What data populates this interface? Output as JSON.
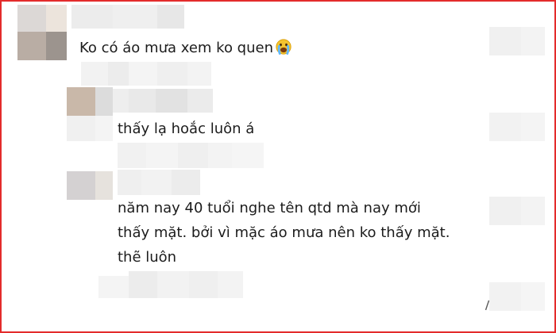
{
  "comments": {
    "c1": "Ko có áo mưa xem ko quen",
    "c2": "thấy lạ hoắc luôn á",
    "c3_line1": "năm nay 40 tuổi nghe tên qtd mà nay mới",
    "c3_line2": "thấy mặt. bởi vì mặc áo mưa nên ko thấy mặt.",
    "c3_line3": "thẽ luôn"
  },
  "emoji": "crying-face-icon",
  "colors": {
    "frame_border": "#e32b2b",
    "text": "#1c1c1c",
    "blur_light": "#ededed",
    "blur_avatar": "#b8ab9f"
  }
}
